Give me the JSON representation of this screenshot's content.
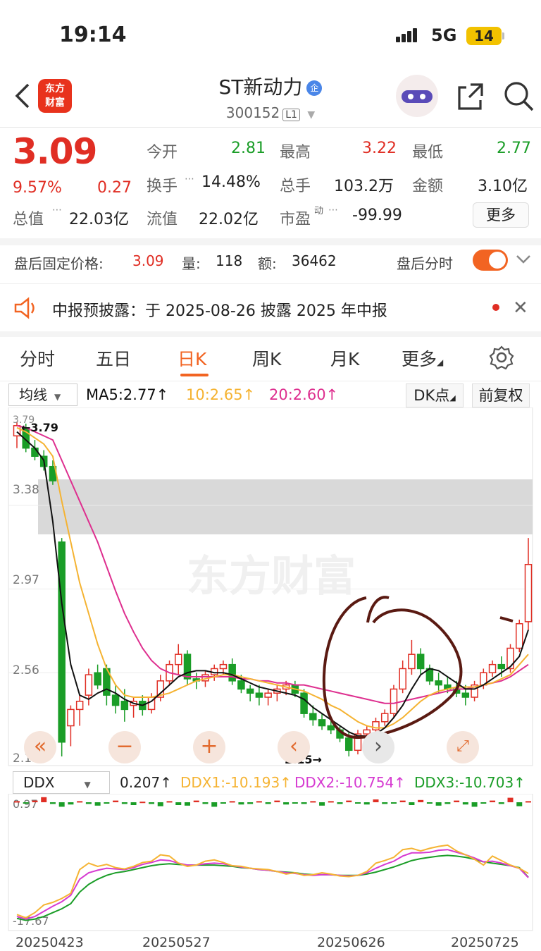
{
  "status_bar": {
    "time": "19:14",
    "network": "5G",
    "battery": "14"
  },
  "header": {
    "back_icon": "chevron-left-icon",
    "logo_lines": [
      "东方",
      "财富"
    ],
    "title": "ST新动力",
    "title_badge": "企",
    "code": "300152",
    "level": "L1",
    "icons": [
      "assistant-avatar-icon",
      "share-icon",
      "search-icon"
    ]
  },
  "quote": {
    "price": "3.09",
    "change_pct": "9.57%",
    "change": "0.27",
    "open_label": "今开",
    "open": "2.81",
    "high_label": "最高",
    "high": "3.22",
    "low_label": "最低",
    "low": "2.77",
    "turnover_label": "换手",
    "turnover": "14.48%",
    "volume_label": "总手",
    "volume": "103.2万",
    "amount_label": "金额",
    "amount": "3.10亿",
    "mktcap_label": "总值",
    "mktcap": "22.03亿",
    "float_label": "流值",
    "float_cap": "22.02亿",
    "pe_label": "市盈",
    "pe_sup": "动",
    "pe": "-99.99",
    "more_button": "更多"
  },
  "after_hours": {
    "price_label": "盘后固定价格:",
    "price": "3.09",
    "vol_label": "量:",
    "vol": "118",
    "amt_label": "额:",
    "amt": "36462",
    "intraday_label": "盘后分时"
  },
  "notice": {
    "text": "中报预披露：于 2025-08-26 披露 2025 年中报"
  },
  "tabs": [
    "分时",
    "五日",
    "日K",
    "周K",
    "月K",
    "更多"
  ],
  "active_tab": "日K",
  "ma_bar": {
    "select": "均线",
    "ma5": "MA5:2.77↑",
    "ma10": "10:2.65↑",
    "ma20": "20:2.60↑",
    "dk_button": "DK点",
    "adjust_button": "前复权"
  },
  "colors": {
    "up": "#e02e24",
    "down": "#1a9d27",
    "ma5": "#111111",
    "ma10": "#f5b332",
    "ma20": "#de2f8f",
    "accent": "#f26422"
  },
  "chart_labels": {
    "y_ticks": [
      "3.79",
      "3.38",
      "2.97",
      "2.56",
      "2.15"
    ],
    "high_mark": "3.79",
    "low_mark": "2.15",
    "watermark": "东方财富"
  },
  "ddx_bar": {
    "select": "DDX",
    "ddx": "0.207↑",
    "ddx1": "DDX1:-10.193↑",
    "ddx2": "DDX2:-10.754↑",
    "ddx3": "DDX3:-10.703↑",
    "top": "0.97",
    "bottom": "-17.67"
  },
  "dates": [
    "20250423",
    "20250527",
    "20250626",
    "20250725"
  ],
  "chart_data": {
    "type": "candlestick",
    "y_range": [
      2.15,
      3.79
    ],
    "ohlc": [
      [
        3.72,
        3.79,
        3.66,
        3.77
      ],
      [
        3.76,
        3.78,
        3.64,
        3.66
      ],
      [
        3.66,
        3.7,
        3.6,
        3.62
      ],
      [
        3.62,
        3.65,
        3.55,
        3.57
      ],
      [
        3.57,
        3.6,
        3.48,
        3.5
      ],
      [
        3.2,
        3.22,
        2.15,
        2.22
      ],
      [
        2.3,
        2.4,
        2.2,
        2.38
      ],
      [
        2.38,
        2.45,
        2.3,
        2.42
      ],
      [
        2.45,
        2.58,
        2.4,
        2.55
      ],
      [
        2.56,
        2.6,
        2.48,
        2.5
      ],
      [
        2.58,
        2.6,
        2.4,
        2.45
      ],
      [
        2.45,
        2.5,
        2.36,
        2.4
      ],
      [
        2.42,
        2.48,
        2.32,
        2.38
      ],
      [
        2.4,
        2.44,
        2.34,
        2.42
      ],
      [
        2.42,
        2.45,
        2.35,
        2.38
      ],
      [
        2.38,
        2.46,
        2.36,
        2.44
      ],
      [
        2.44,
        2.55,
        2.42,
        2.52
      ],
      [
        2.52,
        2.62,
        2.5,
        2.6
      ],
      [
        2.6,
        2.7,
        2.55,
        2.65
      ],
      [
        2.65,
        2.67,
        2.5,
        2.53
      ],
      [
        2.53,
        2.56,
        2.48,
        2.52
      ],
      [
        2.52,
        2.57,
        2.49,
        2.55
      ],
      [
        2.55,
        2.6,
        2.52,
        2.58
      ],
      [
        2.58,
        2.62,
        2.55,
        2.6
      ],
      [
        2.6,
        2.63,
        2.5,
        2.52
      ],
      [
        2.52,
        2.55,
        2.46,
        2.48
      ],
      [
        2.48,
        2.5,
        2.42,
        2.46
      ],
      [
        2.46,
        2.5,
        2.4,
        2.44
      ],
      [
        2.44,
        2.48,
        2.4,
        2.46
      ],
      [
        2.46,
        2.5,
        2.42,
        2.48
      ],
      [
        2.48,
        2.52,
        2.45,
        2.5
      ],
      [
        2.5,
        2.52,
        2.44,
        2.46
      ],
      [
        2.46,
        2.48,
        2.34,
        2.36
      ],
      [
        2.36,
        2.4,
        2.3,
        2.33
      ],
      [
        2.33,
        2.36,
        2.28,
        2.3
      ],
      [
        2.3,
        2.33,
        2.26,
        2.28
      ],
      [
        2.28,
        2.3,
        2.22,
        2.24
      ],
      [
        2.24,
        2.27,
        2.15,
        2.18
      ],
      [
        2.18,
        2.28,
        2.16,
        2.26
      ],
      [
        2.26,
        2.3,
        2.24,
        2.28
      ],
      [
        2.28,
        2.34,
        2.26,
        2.32
      ],
      [
        2.32,
        2.38,
        2.3,
        2.36
      ],
      [
        2.36,
        2.5,
        2.34,
        2.48
      ],
      [
        2.48,
        2.62,
        2.46,
        2.58
      ],
      [
        2.58,
        2.72,
        2.55,
        2.65
      ],
      [
        2.65,
        2.68,
        2.55,
        2.58
      ],
      [
        2.58,
        2.6,
        2.5,
        2.52
      ],
      [
        2.52,
        2.56,
        2.46,
        2.5
      ],
      [
        2.5,
        2.54,
        2.46,
        2.48
      ],
      [
        2.48,
        2.52,
        2.44,
        2.46
      ],
      [
        2.46,
        2.5,
        2.4,
        2.44
      ],
      [
        2.44,
        2.52,
        2.42,
        2.5
      ],
      [
        2.5,
        2.58,
        2.48,
        2.56
      ],
      [
        2.56,
        2.62,
        2.54,
        2.6
      ],
      [
        2.6,
        2.64,
        2.54,
        2.58
      ],
      [
        2.58,
        2.7,
        2.56,
        2.68
      ],
      [
        2.68,
        2.82,
        2.66,
        2.8
      ],
      [
        2.81,
        3.22,
        2.77,
        3.09
      ]
    ],
    "ma5": [
      3.74,
      3.7,
      3.66,
      3.6,
      3.3,
      2.9,
      2.6,
      2.45,
      2.43,
      2.46,
      2.48,
      2.46,
      2.43,
      2.41,
      2.4,
      2.42,
      2.46,
      2.5,
      2.54,
      2.56,
      2.57,
      2.57,
      2.56,
      2.56,
      2.55,
      2.53,
      2.51,
      2.49,
      2.48,
      2.47,
      2.46,
      2.45,
      2.43,
      2.39,
      2.36,
      2.33,
      2.3,
      2.27,
      2.25,
      2.25,
      2.26,
      2.29,
      2.34,
      2.4,
      2.48,
      2.55,
      2.58,
      2.57,
      2.54,
      2.51,
      2.48,
      2.48,
      2.5,
      2.53,
      2.56,
      2.59,
      2.64,
      2.77
    ],
    "ma10": [
      3.76,
      3.74,
      3.71,
      3.68,
      3.62,
      3.4,
      3.2,
      3.0,
      2.85,
      2.7,
      2.58,
      2.5,
      2.45,
      2.44,
      2.44,
      2.44,
      2.45,
      2.46,
      2.48,
      2.5,
      2.52,
      2.53,
      2.54,
      2.55,
      2.55,
      2.54,
      2.53,
      2.52,
      2.51,
      2.5,
      2.49,
      2.48,
      2.47,
      2.45,
      2.43,
      2.4,
      2.38,
      2.35,
      2.32,
      2.3,
      2.29,
      2.29,
      2.31,
      2.34,
      2.38,
      2.42,
      2.45,
      2.47,
      2.48,
      2.49,
      2.49,
      2.49,
      2.5,
      2.51,
      2.53,
      2.55,
      2.6,
      2.65
    ],
    "ma20": [
      3.77,
      3.76,
      3.74,
      3.72,
      3.7,
      3.6,
      3.5,
      3.4,
      3.3,
      3.2,
      3.08,
      2.96,
      2.85,
      2.76,
      2.68,
      2.62,
      2.58,
      2.56,
      2.55,
      2.54,
      2.54,
      2.54,
      2.54,
      2.54,
      2.54,
      2.53,
      2.53,
      2.52,
      2.52,
      2.51,
      2.51,
      2.5,
      2.5,
      2.49,
      2.48,
      2.47,
      2.46,
      2.45,
      2.44,
      2.43,
      2.42,
      2.41,
      2.41,
      2.42,
      2.43,
      2.44,
      2.45,
      2.46,
      2.47,
      2.48,
      2.48,
      2.49,
      2.5,
      2.51,
      2.52,
      2.54,
      2.57,
      2.6
    ],
    "ddx_bars": [
      0.2,
      -0.2,
      0.3,
      0.9,
      -0.3,
      -0.8,
      -0.4,
      0.2,
      -0.3,
      -0.6,
      -0.2,
      0.3,
      -0.3,
      -0.5,
      0.1,
      -0.3,
      -0.7,
      0.2,
      -0.5,
      -0.6,
      0.3,
      -0.3,
      -0.8,
      -0.2,
      0.2,
      -0.4,
      -0.3,
      0.2,
      -0.3,
      0.3,
      -0.4,
      -0.2,
      -0.3,
      0.2,
      -0.6,
      0.2,
      -0.3,
      0.3,
      -0.2,
      -0.4,
      0.5,
      -0.3,
      -0.2,
      0.3,
      -0.5,
      0.4,
      -0.2,
      -0.6,
      -0.3,
      0.3,
      -0.4,
      -0.8,
      -0.2,
      0.3,
      -0.3,
      0.8,
      -0.7,
      0.2
    ],
    "ddx1": [
      -16.5,
      -17.0,
      -16.2,
      -15.0,
      -14.6,
      -14.0,
      -13.2,
      -9.5,
      -8.5,
      -9.0,
      -8.7,
      -9.2,
      -9.4,
      -9.0,
      -8.4,
      -8.2,
      -7.2,
      -7.4,
      -8.5,
      -9.0,
      -8.8,
      -8.2,
      -8.0,
      -8.4,
      -8.9,
      -9.0,
      -9.3,
      -9.4,
      -9.5,
      -9.8,
      -10.2,
      -10.0,
      -10.4,
      -10.3,
      -10.0,
      -10.2,
      -10.5,
      -10.6,
      -10.4,
      -9.8,
      -8.5,
      -8.1,
      -7.6,
      -6.4,
      -6.2,
      -6.6,
      -6.2,
      -5.9,
      -5.7,
      -6.6,
      -7.2,
      -7.9,
      -8.8,
      -7.4,
      -8.1,
      -8.8,
      -9.3,
      -10.1
    ],
    "ddx2": [
      -16.8,
      -17.2,
      -16.8,
      -16.0,
      -15.2,
      -14.5,
      -13.5,
      -11.0,
      -10.0,
      -9.6,
      -9.3,
      -9.4,
      -9.5,
      -9.2,
      -8.7,
      -8.4,
      -8.0,
      -8.1,
      -8.5,
      -8.8,
      -8.8,
      -8.6,
      -8.5,
      -8.6,
      -8.9,
      -9.1,
      -9.3,
      -9.5,
      -9.6,
      -9.8,
      -10.0,
      -10.1,
      -10.3,
      -10.4,
      -10.3,
      -10.3,
      -10.4,
      -10.5,
      -10.4,
      -10.0,
      -9.3,
      -8.7,
      -8.2,
      -7.4,
      -6.9,
      -6.9,
      -6.8,
      -6.5,
      -6.4,
      -6.8,
      -7.2,
      -7.7,
      -8.3,
      -8.2,
      -8.5,
      -8.9,
      -9.3,
      -10.75
    ],
    "ddx3": [
      -17.1,
      -17.4,
      -17.2,
      -16.8,
      -16.2,
      -15.6,
      -14.8,
      -13.0,
      -11.8,
      -11.0,
      -10.4,
      -10.0,
      -9.8,
      -9.5,
      -9.2,
      -8.9,
      -8.7,
      -8.6,
      -8.7,
      -8.8,
      -8.8,
      -8.8,
      -8.8,
      -8.9,
      -9.0,
      -9.2,
      -9.3,
      -9.5,
      -9.6,
      -9.8,
      -9.9,
      -10.0,
      -10.2,
      -10.3,
      -10.3,
      -10.3,
      -10.4,
      -10.4,
      -10.4,
      -10.2,
      -9.9,
      -9.5,
      -9.1,
      -8.6,
      -8.1,
      -7.8,
      -7.6,
      -7.4,
      -7.3,
      -7.4,
      -7.6,
      -7.9,
      -8.3,
      -8.5,
      -8.7,
      -8.9,
      -9.2,
      -10.7
    ],
    "ddx_range": [
      -17.67,
      0.97
    ]
  }
}
